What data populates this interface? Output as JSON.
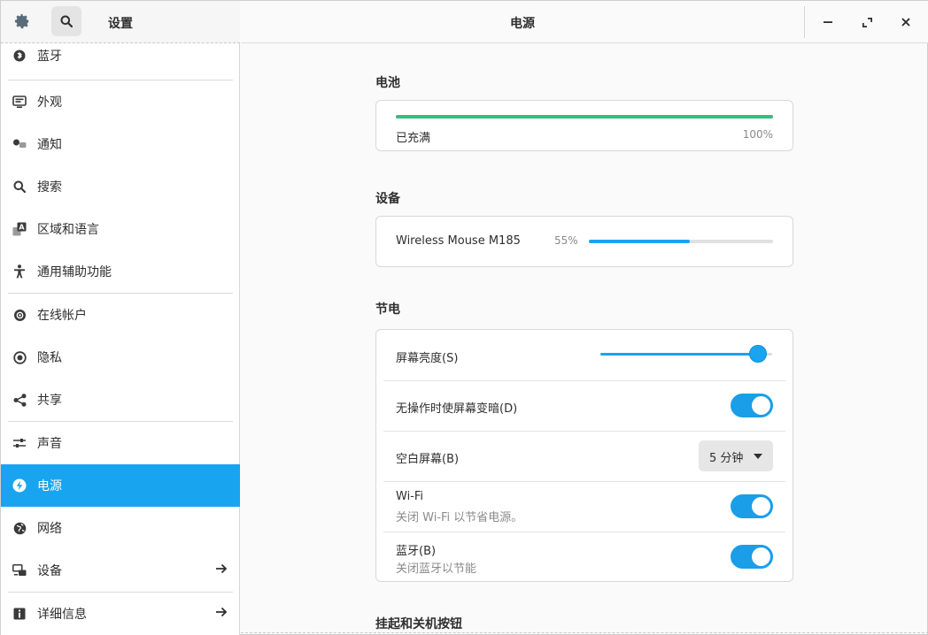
{
  "app": {
    "sidebar_title": "设置",
    "page_title": "电源"
  },
  "sidebar": {
    "items": [
      {
        "label": "蓝牙",
        "icon": "bluetooth-icon"
      },
      {
        "label": "外观",
        "icon": "monitor-icon"
      },
      {
        "label": "通知",
        "icon": "notification-icon"
      },
      {
        "label": "搜索",
        "icon": "search-icon"
      },
      {
        "label": "区域和语言",
        "icon": "language-icon"
      },
      {
        "label": "通用辅助功能",
        "icon": "accessibility-icon"
      },
      {
        "label": "在线帐户",
        "icon": "online-accounts-icon"
      },
      {
        "label": "隐私",
        "icon": "privacy-icon"
      },
      {
        "label": "共享",
        "icon": "share-icon"
      },
      {
        "label": "声音",
        "icon": "sound-icon"
      },
      {
        "label": "电源",
        "icon": "power-icon",
        "active": true
      },
      {
        "label": "网络",
        "icon": "network-icon"
      },
      {
        "label": "设备",
        "icon": "devices-icon",
        "arrow": true
      },
      {
        "label": "详细信息",
        "icon": "info-icon",
        "arrow": true
      }
    ]
  },
  "battery": {
    "section_title": "电池",
    "status": "已充满",
    "percent_text": "100%",
    "level": 1.0
  },
  "devices": {
    "section_title": "设备",
    "name": "Wireless Mouse M185",
    "percent_text": "55%",
    "level": 0.55
  },
  "power_saving": {
    "section_title": "节电",
    "brightness_label": "屏幕亮度(S)",
    "brightness_level": 0.92,
    "dim_label": "无操作时使屏幕变暗(D)",
    "dim_on": true,
    "blank_label": "空白屏幕(B)",
    "blank_value": "5 分钟",
    "wifi_label": "Wi-Fi",
    "wifi_sub": "关闭 Wi-Fi 以节省电源。",
    "wifi_on": true,
    "bt_label": "蓝牙(B)",
    "bt_sub": "关闭蓝牙以节能",
    "bt_on": true
  },
  "suspend": {
    "section_title": "挂起和关机按钮"
  },
  "colors": {
    "accent": "#19a4ef",
    "battery_bar": "#2ec27e",
    "toggle_on": "#1a9ee8"
  }
}
